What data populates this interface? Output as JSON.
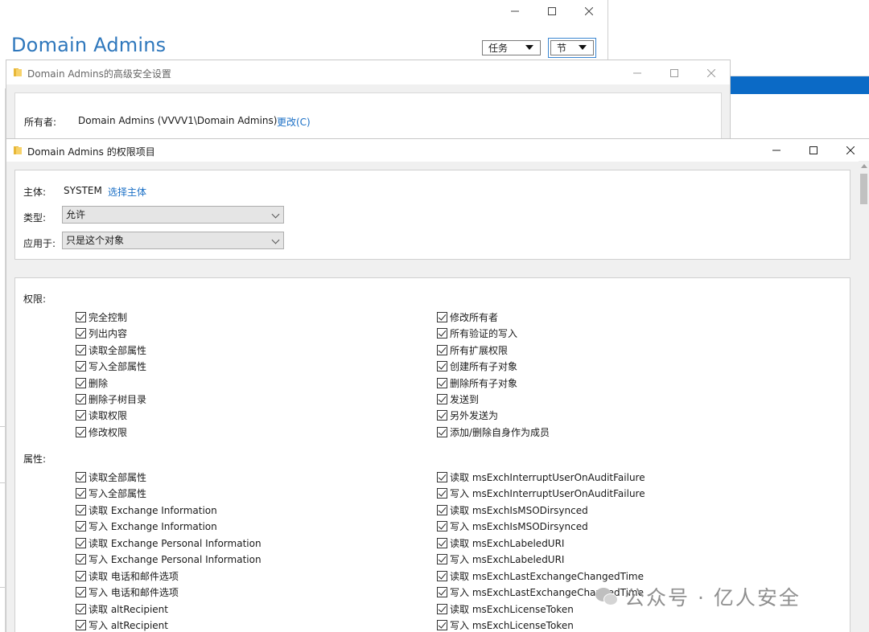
{
  "win1": {
    "title": "Domain Admins",
    "task_label": "任务",
    "section_label": "节"
  },
  "win2": {
    "title": "Domain Admins的高级安全设置",
    "owner_label": "所有者:",
    "owner_value": "Domain Admins (VVVV1\\Domain Admins)",
    "change_link": "更改(C)"
  },
  "win3": {
    "title": "Domain Admins 的权限项目",
    "principal_label": "主体:",
    "principal_value": "SYSTEM",
    "select_principal": "选择主体",
    "type_label": "类型:",
    "type_value": "允许",
    "apply_label": "应用于:",
    "apply_value": "只是这个对象"
  },
  "permissions": {
    "title": "权限:",
    "left": [
      "完全控制",
      "列出内容",
      "读取全部属性",
      "写入全部属性",
      "删除",
      "删除子树目录",
      "读取权限",
      "修改权限"
    ],
    "right": [
      "修改所有者",
      "所有验证的写入",
      "所有扩展权限",
      "创建所有子对象",
      "删除所有子对象",
      "发送到",
      "另外发送为",
      "添加/删除自身作为成员"
    ]
  },
  "properties": {
    "title": "属性:",
    "left": [
      "读取全部属性",
      "写入全部属性",
      "读取 Exchange Information",
      "写入 Exchange Information",
      "读取 Exchange Personal Information",
      "写入 Exchange Personal Information",
      "读取 电话和邮件选项",
      "写入 电话和邮件选项",
      "读取 altRecipient",
      "写入 altRecipient"
    ],
    "right": [
      "读取 msExchInterruptUserOnAuditFailure",
      "写入 msExchInterruptUserOnAuditFailure",
      "读取 msExchIsMSODirsynced",
      "写入 msExchIsMSODirsynced",
      "读取 msExchLabeledURI",
      "写入 msExchLabeledURI",
      "读取 msExchLastExchangeChangedTime",
      "写入 msExchLastExchangeChangedTime",
      "读取 msExchLicenseToken",
      "写入 msExchLicenseToken"
    ]
  },
  "watermark": "公众号 · 亿人安全",
  "icons": {
    "folder": "folder-icon",
    "minimize": "minimize-icon",
    "maximize": "maximize-icon",
    "close": "close-icon",
    "wechat": "wechat-icon"
  }
}
